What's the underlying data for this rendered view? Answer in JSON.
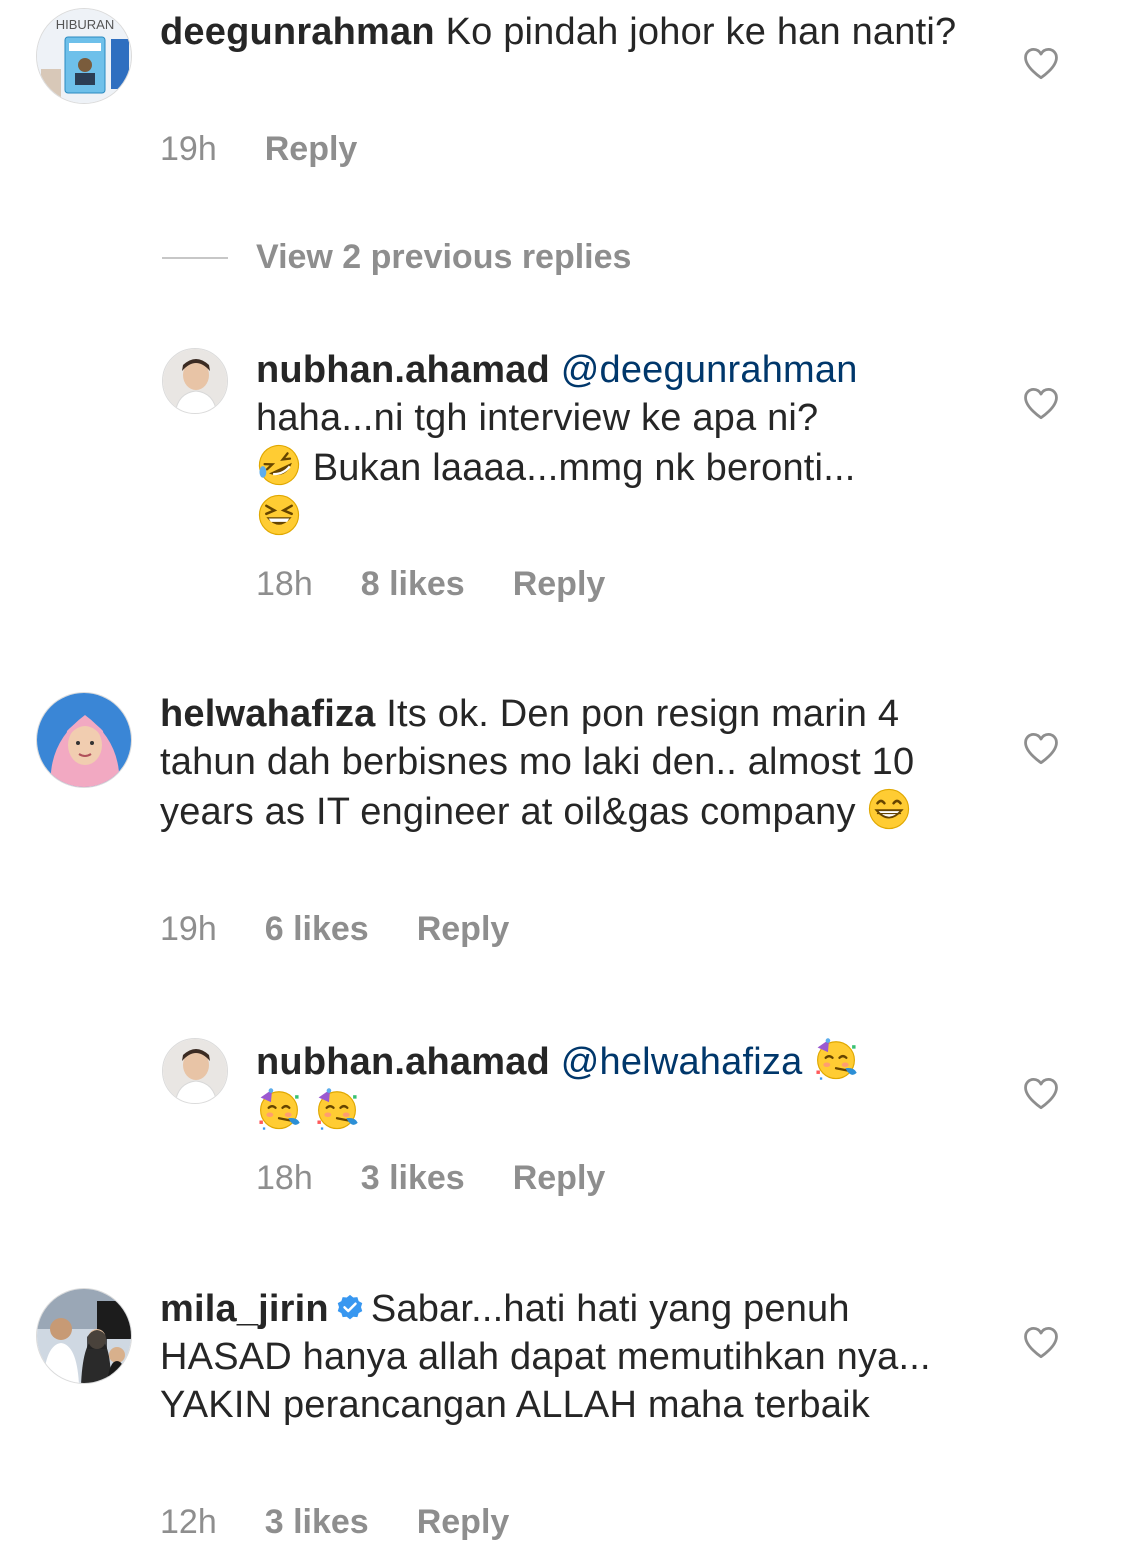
{
  "comments": [
    {
      "username": "deegunrahman",
      "text": "Ko pindah johor ke han nanti?",
      "time": "19h",
      "likes": "",
      "reply": "Reply",
      "avatar_label": "HIBURAN"
    },
    {
      "username": "nubhan.ahamad",
      "mention": "@deegunrahman",
      "text_a": "haha...ni tgh interview ke apa ni?",
      "text_b": "Bukan laaaa...mmg nk beronti...",
      "time": "18h",
      "likes": "8 likes",
      "reply": "Reply"
    },
    {
      "username": "helwahafiza",
      "text": "Its ok. Den pon resign marin 4 tahun dah berbisnes mo laki den.. almost 10 years as IT engineer at oil&gas company",
      "time": "19h",
      "likes": "6 likes",
      "reply": "Reply"
    },
    {
      "username": "nubhan.ahamad",
      "mention": "@helwahafiza",
      "time": "18h",
      "likes": "3 likes",
      "reply": "Reply"
    },
    {
      "username": "mila_jirin",
      "text": "Sabar...hati hati yang penuh HASAD hanya allah dapat memutihkan nya... YAKIN perancangan ALLAH maha terbaik",
      "time": "12h",
      "likes": "3 likes",
      "reply": "Reply"
    }
  ],
  "view_previous_replies": "View 2 previous replies",
  "colors": {
    "text": "#262626",
    "meta": "#8e8e8e",
    "mention": "#00376b",
    "verified": "#3897f0"
  }
}
